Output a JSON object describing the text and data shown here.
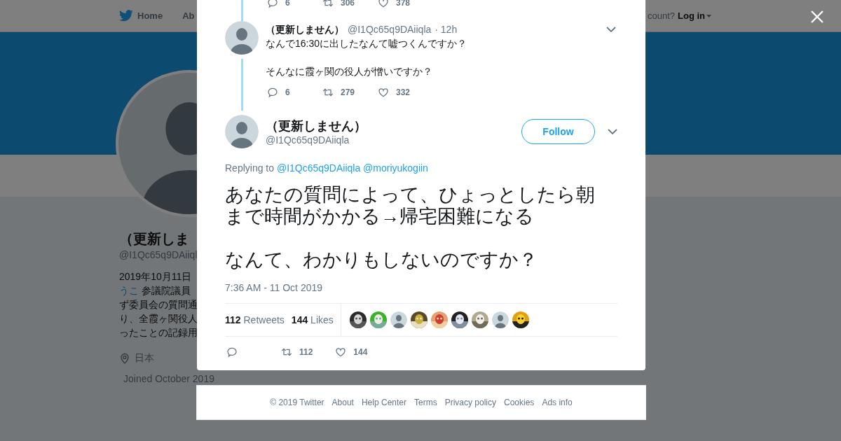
{
  "background_page": {
    "nav": {
      "items": [
        {
          "label": "Home"
        },
        {
          "label": "Ab"
        }
      ],
      "account_prompt": "count?",
      "login": "Log in"
    },
    "profile": {
      "name": "（更新しま",
      "handle": "@I1Qc65q9DAiiql",
      "bio_lines": [
        {
          "text": "2019年10月11日"
        },
        {
          "link": "うこ",
          "text": "参議院議員"
        },
        {
          "text": "ず委員会の質問通"
        },
        {
          "text": "り、全霞ヶ関役人"
        },
        {
          "text": "ったことの記録用"
        }
      ],
      "location": "日本",
      "joined": "Joined October 2019"
    }
  },
  "modal": {
    "previous_tweet_actions": {
      "replies": "6",
      "retweets": "306",
      "likes": "378"
    },
    "reply_tweet": {
      "name": "（更新しません）",
      "handle": "@I1Qc65q9DAiiqla",
      "time": "· 12h",
      "paragraphs": [
        "なんで16:30に出したなんて嘘つくんですか？",
        "そんなに霞ヶ関の役人が憎いですか？"
      ],
      "replies": "6",
      "retweets": "279",
      "likes": "332"
    },
    "main_tweet": {
      "name": "（更新しません）",
      "handle": "@I1Qc65q9DAiiqla",
      "follow_label": "Follow",
      "replying_label": "Replying to",
      "mentions": [
        "@I1Qc65q9DAiiqla",
        "@moriyukogiin"
      ],
      "paragraphs": [
        "あなたの質問によって、ひょっとしたら朝まで時間がかかる→帰宅困難になる",
        "なんて、わかりもしないのですか？"
      ],
      "timestamp": "7:36 AM - 11 Oct 2019",
      "retweet_count": "112",
      "retweet_label": "Retweets",
      "like_count": "144",
      "like_label": "Likes",
      "likers": [
        {
          "kind": "picture"
        },
        {
          "kind": "picture"
        },
        {
          "kind": "default"
        },
        {
          "kind": "picture"
        },
        {
          "kind": "picture"
        },
        {
          "kind": "picture"
        },
        {
          "kind": "picture"
        },
        {
          "kind": "default"
        },
        {
          "kind": "picture"
        }
      ],
      "actions": {
        "retweets": "112",
        "likes": "144"
      }
    }
  },
  "footer": {
    "links": [
      "© 2019 Twitter",
      "About",
      "Help Center",
      "Terms",
      "Privacy policy",
      "Cookies",
      "Ads info"
    ]
  }
}
